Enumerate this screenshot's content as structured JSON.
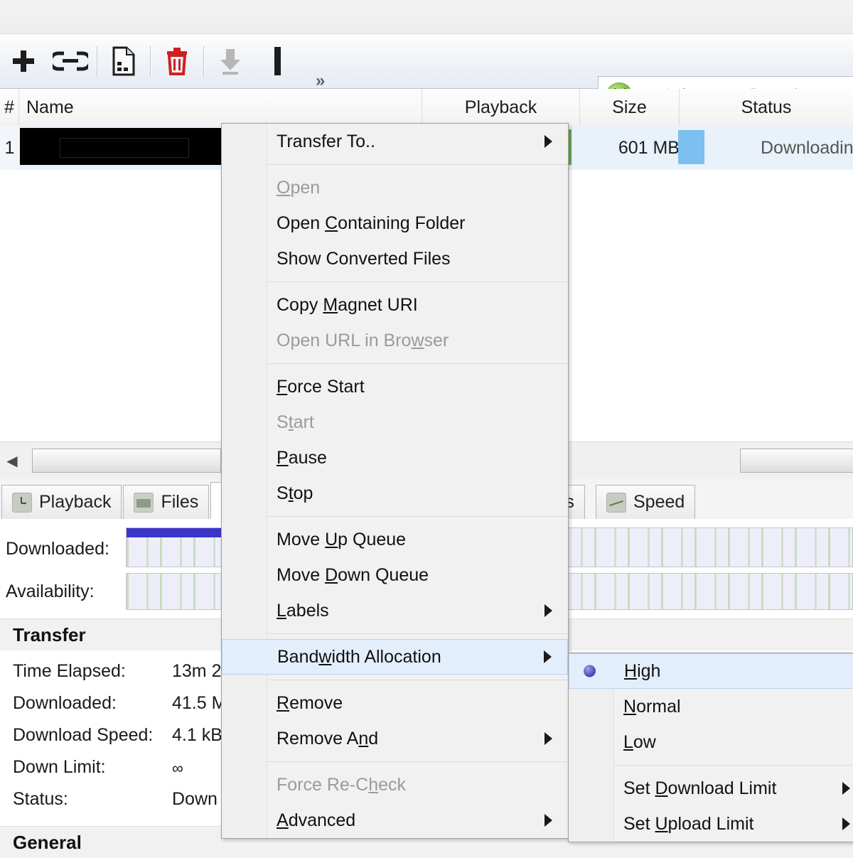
{
  "toolbar": {
    "buttons": [
      {
        "name": "add-torrent-button",
        "icon": "plus-icon"
      },
      {
        "name": "add-torrent-from-url-button",
        "icon": "link-icon"
      },
      {
        "name": "create-new-torrent-button",
        "icon": "document-icon"
      },
      {
        "name": "remove-torrent-button",
        "icon": "trash-icon"
      },
      {
        "name": "start-torrent-button",
        "icon": "download-arrow-icon"
      },
      {
        "name": "pause-torrent-button",
        "icon": "pause-bar-icon"
      }
    ],
    "overflow_glyph": "»",
    "survey_link": "Take our survey",
    "search_placeholder": "Infospace Search",
    "search_value": ""
  },
  "list": {
    "columns": [
      {
        "label": "#"
      },
      {
        "label": "Name"
      },
      {
        "label": "Playback"
      },
      {
        "label": "Size"
      },
      {
        "label": "Status"
      }
    ],
    "rows": [
      {
        "num": "1",
        "name": "",
        "playback": "",
        "size": "601 MB",
        "status": "Downloading"
      }
    ]
  },
  "detail_tabs": [
    {
      "label": "Playback",
      "icon": "clock-icon",
      "active": false
    },
    {
      "label": "Files",
      "icon": "folder-icon",
      "active": false
    },
    {
      "label": "",
      "icon": "info-icon",
      "active": true
    },
    {
      "label": "rs",
      "icon": "peers-icon",
      "active": false
    },
    {
      "label": "Speed",
      "icon": "graph-icon",
      "active": false
    }
  ],
  "detail": {
    "downloaded_label": "Downloaded:",
    "availability_label": "Availability:",
    "downloaded_percent": 37,
    "transfer": {
      "heading": "Transfer",
      "rows": [
        {
          "key": "Time Elapsed:",
          "value": "13m 2"
        },
        {
          "key": "Downloaded:",
          "value": "41.5 M"
        },
        {
          "key": "Download Speed:",
          "value": "4.1 kB"
        },
        {
          "key": "Down Limit:",
          "value": "∞"
        },
        {
          "key": "Status:",
          "value": "Down"
        }
      ]
    },
    "general": {
      "heading": "General"
    }
  },
  "context_menu": {
    "items": [
      {
        "type": "item",
        "label": "Transfer To..",
        "accel": "",
        "submenu": true,
        "disabled": false
      },
      {
        "type": "separator"
      },
      {
        "type": "item",
        "label": "Open",
        "accel": "O",
        "submenu": false,
        "disabled": true
      },
      {
        "type": "item",
        "label": "Open Containing Folder",
        "accel": "C",
        "submenu": false,
        "disabled": false
      },
      {
        "type": "item",
        "label": "Show Converted Files",
        "accel": "",
        "submenu": false,
        "disabled": false
      },
      {
        "type": "separator"
      },
      {
        "type": "item",
        "label": "Copy Magnet URI",
        "accel": "M",
        "submenu": false,
        "disabled": false
      },
      {
        "type": "item",
        "label": "Open URL in Browser",
        "accel": "w",
        "submenu": false,
        "disabled": true
      },
      {
        "type": "separator"
      },
      {
        "type": "item",
        "label": "Force Start",
        "accel": "F",
        "submenu": false,
        "disabled": false
      },
      {
        "type": "item",
        "label": "Start",
        "accel": "t",
        "submenu": false,
        "disabled": true
      },
      {
        "type": "item",
        "label": "Pause",
        "accel": "P",
        "submenu": false,
        "disabled": false
      },
      {
        "type": "item",
        "label": "Stop",
        "accel": "t",
        "submenu": false,
        "disabled": false
      },
      {
        "type": "separator"
      },
      {
        "type": "item",
        "label": "Move Up Queue",
        "accel": "U",
        "submenu": false,
        "disabled": false
      },
      {
        "type": "item",
        "label": "Move Down Queue",
        "accel": "D",
        "submenu": false,
        "disabled": false
      },
      {
        "type": "item",
        "label": "Labels",
        "accel": "L",
        "submenu": true,
        "disabled": false
      },
      {
        "type": "separator"
      },
      {
        "type": "item",
        "label": "Bandwidth Allocation",
        "accel": "w",
        "submenu": true,
        "disabled": false,
        "highlighted": true
      },
      {
        "type": "separator"
      },
      {
        "type": "item",
        "label": "Remove",
        "accel": "R",
        "submenu": false,
        "disabled": false
      },
      {
        "type": "item",
        "label": "Remove And",
        "accel": "n",
        "submenu": true,
        "disabled": false
      },
      {
        "type": "separator"
      },
      {
        "type": "item",
        "label": "Force Re-Check",
        "accel": "h",
        "submenu": false,
        "disabled": true
      },
      {
        "type": "item",
        "label": "Advanced",
        "accel": "A",
        "submenu": true,
        "disabled": false
      }
    ]
  },
  "bandwidth_submenu": {
    "items": [
      {
        "type": "item",
        "label": "High",
        "accel": "H",
        "selected": true,
        "highlighted": true,
        "submenu": false
      },
      {
        "type": "item",
        "label": "Normal",
        "accel": "N",
        "selected": false,
        "highlighted": false,
        "submenu": false
      },
      {
        "type": "item",
        "label": "Low",
        "accel": "L",
        "selected": false,
        "highlighted": false,
        "submenu": false
      },
      {
        "type": "separator"
      },
      {
        "type": "item",
        "label": "Set Download Limit",
        "accel": "D",
        "selected": false,
        "highlighted": false,
        "submenu": true
      },
      {
        "type": "item",
        "label": "Set Upload Limit",
        "accel": "U",
        "selected": false,
        "highlighted": false,
        "submenu": true
      }
    ]
  },
  "colors": {
    "accent_blue": "#3a35c8",
    "highlight": "#e3eefc",
    "link": "#2a5db0",
    "progress_blue": "#7cc0f0",
    "green": "#6aa84f"
  }
}
